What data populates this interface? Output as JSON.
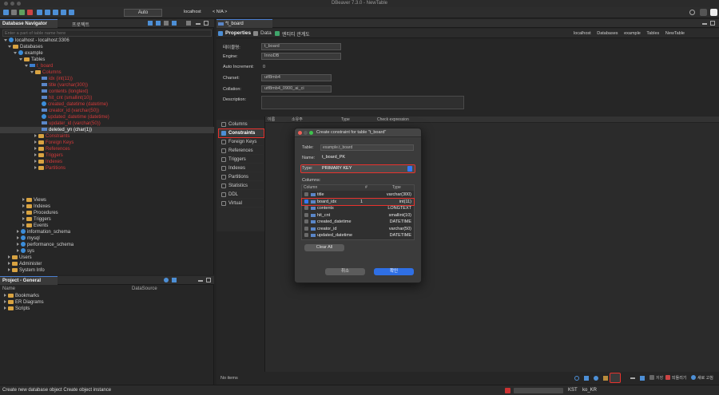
{
  "app": {
    "title": "DBeaver 7.3.0 - NewTable"
  },
  "toolbar": {
    "transaction_label": "Auto",
    "connection_label": "localhost",
    "schema_label": "< N/A >"
  },
  "navigator": {
    "tab_label": "Database Navigator",
    "tab2_label": "프로젝트",
    "filter_placeholder": "Enter a part of table name here",
    "items": [
      {
        "label": "localhost - localhost:3306"
      },
      {
        "label": "Databases"
      },
      {
        "label": "example"
      },
      {
        "label": "Tables"
      },
      {
        "label": "t_board"
      },
      {
        "label": "Columns"
      },
      {
        "label": "idx (int(11))"
      },
      {
        "label": "title (varchar(300))"
      },
      {
        "label": "contents (longtext)"
      },
      {
        "label": "hit_cnt (smallint(10))"
      },
      {
        "label": "created_datetime (datetime)"
      },
      {
        "label": "creator_id (varchar(50))"
      },
      {
        "label": "updated_datetime (datetime)"
      },
      {
        "label": "updater_id (varchar(50))"
      },
      {
        "label": "deleted_yn (char(1))"
      },
      {
        "label": "Constraints"
      },
      {
        "label": "Foreign Keys"
      },
      {
        "label": "References"
      },
      {
        "label": "Triggers"
      },
      {
        "label": "Indexes"
      },
      {
        "label": "Partitions"
      },
      {
        "label": "Views"
      },
      {
        "label": "Indexes"
      },
      {
        "label": "Procedures"
      },
      {
        "label": "Triggers"
      },
      {
        "label": "Events"
      },
      {
        "label": "information_schema"
      },
      {
        "label": "mysql"
      },
      {
        "label": "performance_schema"
      },
      {
        "label": "sys"
      },
      {
        "label": "Users"
      },
      {
        "label": "Administer"
      },
      {
        "label": "System Info"
      }
    ]
  },
  "project": {
    "tab_label": "Project - General",
    "col_name": "Name",
    "col_datasource": "DataSource",
    "items": [
      {
        "label": "Bookmarks"
      },
      {
        "label": "ER Diagrams"
      },
      {
        "label": "Scripts"
      }
    ]
  },
  "editor": {
    "tab_label": "*t_board",
    "subtabs": {
      "properties": "Properties",
      "data": "Data",
      "er": "엔티티 관계도"
    },
    "breadcrumb": {
      "conn": "localhost",
      "dbs": "Databases",
      "db": "example",
      "tables": "Tables",
      "new": "NewTable"
    },
    "form": {
      "name_label": "테이블명:",
      "name_value": "t_board",
      "engine_label": "Engine:",
      "engine_value": "InnoDB",
      "autoinc_label": "Auto Increment:",
      "autoinc_value": "0",
      "charset_label": "Charset:",
      "charset_value": "utf8mb4",
      "collation_label": "Collation:",
      "collation_value": "utf8mb4_0900_ai_ci",
      "desc_label": "Description:"
    },
    "side_tabs": [
      {
        "label": "Columns"
      },
      {
        "label": "Constraints"
      },
      {
        "label": "Foreign Keys"
      },
      {
        "label": "References"
      },
      {
        "label": "Triggers"
      },
      {
        "label": "Indexes"
      },
      {
        "label": "Partitions"
      },
      {
        "label": "Statistics"
      },
      {
        "label": "DDL"
      },
      {
        "label": "Virtual"
      }
    ],
    "grid_headers": {
      "name": "이름",
      "owner": "소유주",
      "type": "Type",
      "check": "Check expression"
    },
    "status": "No items",
    "bottom_btn_save": "저장",
    "bottom_btn_revert": "되돌리기",
    "bottom_btn_refresh": "새로 고침"
  },
  "dialog": {
    "title": "Create constraint for table \"t_board\"",
    "table_label": "Table:",
    "table_value": "example.t_board",
    "name_label": "Name:",
    "name_value": "t_board_PK",
    "type_label": "Type:",
    "type_value": "PRIMARY KEY",
    "columns_label": "Columns:",
    "col_header_column": "Column",
    "col_header_num": "#",
    "col_header_type": "Type",
    "rows": [
      {
        "name": "title",
        "num": "",
        "type": "varchar(300)",
        "checked": false
      },
      {
        "name": "board_idx",
        "num": "1",
        "type": "int(11)",
        "checked": true
      },
      {
        "name": "contents",
        "num": "",
        "type": "LONGTEXT",
        "checked": false
      },
      {
        "name": "hit_cnt",
        "num": "",
        "type": "smallint(10)",
        "checked": false
      },
      {
        "name": "created_datetime",
        "num": "",
        "type": "DATETIME",
        "checked": false
      },
      {
        "name": "creator_id",
        "num": "",
        "type": "varchar(50)",
        "checked": false
      },
      {
        "name": "updated_datetime",
        "num": "",
        "type": "DATETIME",
        "checked": false
      }
    ],
    "clear_all": "Clear All",
    "cancel": "취소",
    "ok": "확인"
  },
  "statusbar": {
    "message": "Create new database object Create object instance",
    "tz": "KST",
    "locale": "ko_KR"
  },
  "colors": {
    "accent": "#3478f6",
    "highlight": "#e8332e",
    "folder": "#d9a341"
  }
}
